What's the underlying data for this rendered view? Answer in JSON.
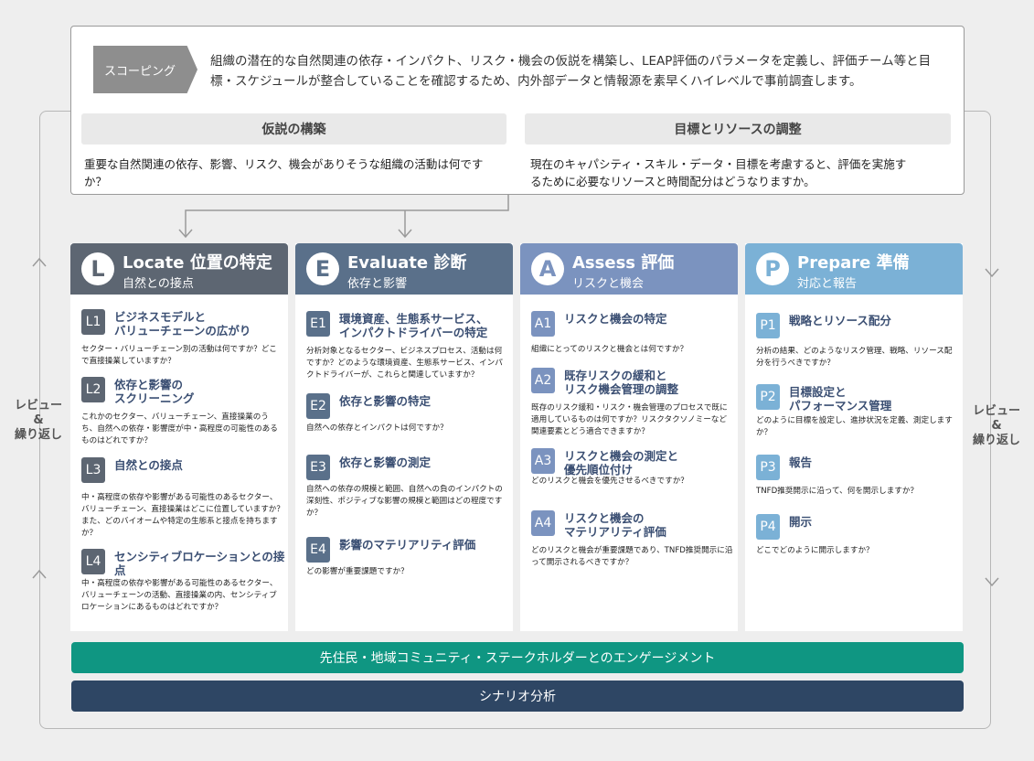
{
  "colors": {
    "locate": "#5d6672",
    "evaluate": "#5a708a",
    "assess": "#7b93bf",
    "prepare": "#7bb1d6",
    "engagement_bar": "#0f9682",
    "scenario_bar": "#2e4664",
    "scoping": "#8e8e8e"
  },
  "scoping": {
    "label": "スコーピング",
    "text": "組織の潜在的な自然関連の依存・インパクト、リスク・機会の仮説を構築し、LEAP評価のパラメータを定義し、評価チーム等と目標・スケジュールが整合していることを確認するため、内外部データと情報源を素早くハイレベルで事前調査します。",
    "hypothesis": {
      "title": "仮説の構築",
      "question": "重要な自然関連の依存、影響、リスク、機会がありそうな組織の活動は何ですか？"
    },
    "resources": {
      "title": "目標とリソースの調整",
      "question": "現在のキャパシティ・スキル・データ・目標を考慮すると、評価を実施するために必要なリソースと時間配分はどうなりますか。"
    }
  },
  "side_labels": {
    "left": "レビュー\n&\n繰り返し",
    "right": "レビュー\n&\n繰り返し"
  },
  "phases": [
    {
      "letter": "L",
      "title": "Locate 位置の特定",
      "subtitle": "自然との接点",
      "items": [
        {
          "code": "L1",
          "title": "ビジネスモデルと\nバリューチェーンの広がり",
          "desc": "セクター・バリューチェーン別の活動は何ですか？どこで直接操業していますか？"
        },
        {
          "code": "L2",
          "title": "依存と影響の\nスクリーニング",
          "desc": "これかのセクター、バリューチェーン、直接操業のうち、自然への依存・影響度が中・高程度の可能性のあるものはどれですか？"
        },
        {
          "code": "L3",
          "title": "自然との接点",
          "desc": "中・高程度の依存や影響がある可能性のあるセクター、バリューチェーン、直接操業はどこに位置していますか？また、どのバイオームや特定の生態系と接点を持ちますか？"
        },
        {
          "code": "L4",
          "title": "センシティブロケーションとの接点",
          "desc": "中・高程度の依存や影響がある可能性のあるセクター、バリューチェーンの活動、直接操業の内、センシティブロケーションにあるものはどれですか？"
        }
      ]
    },
    {
      "letter": "E",
      "title": "Evaluate 診断",
      "subtitle": "依存と影響",
      "items": [
        {
          "code": "E1",
          "title": "環境資産、生態系サービス、\nインパクトドライバーの特定",
          "desc": "分析対象となるセクター、ビジネスプロセス、活動は何ですか？どのような環境資産、生態系サービス、インパクトドライバーが、これらと関連していますか？"
        },
        {
          "code": "E2",
          "title": "依存と影響の特定",
          "desc": "自然への依存とインパクトは何ですか？"
        },
        {
          "code": "E3",
          "title": "依存と影響の測定",
          "desc": "自然への依存の規模と範囲、自然への負のインパクトの深刻性、ポジティブな影響の規模と範囲はどの程度ですか？"
        },
        {
          "code": "E4",
          "title": "影響のマテリアリティ評価",
          "desc": "どの影響が重要課題ですか？"
        }
      ]
    },
    {
      "letter": "A",
      "title": "Assess 評価",
      "subtitle": "リスクと機会",
      "items": [
        {
          "code": "A1",
          "title": "リスクと機会の特定",
          "desc": "組織にとってのリスクと機会とは何ですか？"
        },
        {
          "code": "A2",
          "title": "既存リスクの緩和と\nリスク機会管理の調整",
          "desc": "既存のリスク緩和・リスク・機会管理のプロセスで既に適用しているものは何ですか？リスクタクソノミーなど関連要素とどう適合できますか？"
        },
        {
          "code": "A3",
          "title": "リスクと機会の測定と\n優先順位付け",
          "desc": "どのリスクと機会を優先させるべきですか？"
        },
        {
          "code": "A4",
          "title": "リスクと機会の\nマテリアリティ評価",
          "desc": "どのリスクと機会が重要課題であり、TNFD推奨開示に沿って開示されるべきですか？"
        }
      ]
    },
    {
      "letter": "P",
      "title": "Prepare 準備",
      "subtitle": "対応と報告",
      "items": [
        {
          "code": "P1",
          "title": "戦略とリソース配分",
          "desc": "分析の結果、どのようなリスク管理、戦略、リソース配分を行うべきですか？"
        },
        {
          "code": "P2",
          "title": "目標設定と\nパフォーマンス管理",
          "desc": "どのように目標を設定し、進捗状況を定義、測定しますか？"
        },
        {
          "code": "P3",
          "title": "報告",
          "desc": "TNFD推奨開示に沿って、何を開示しますか？"
        },
        {
          "code": "P4",
          "title": "開示",
          "desc": "どこでどのように開示しますか？"
        }
      ]
    }
  ],
  "bars": {
    "engagement": "先住民・地域コミュニティ・ステークホルダーとのエンゲージメント",
    "scenario": "シナリオ分析"
  }
}
